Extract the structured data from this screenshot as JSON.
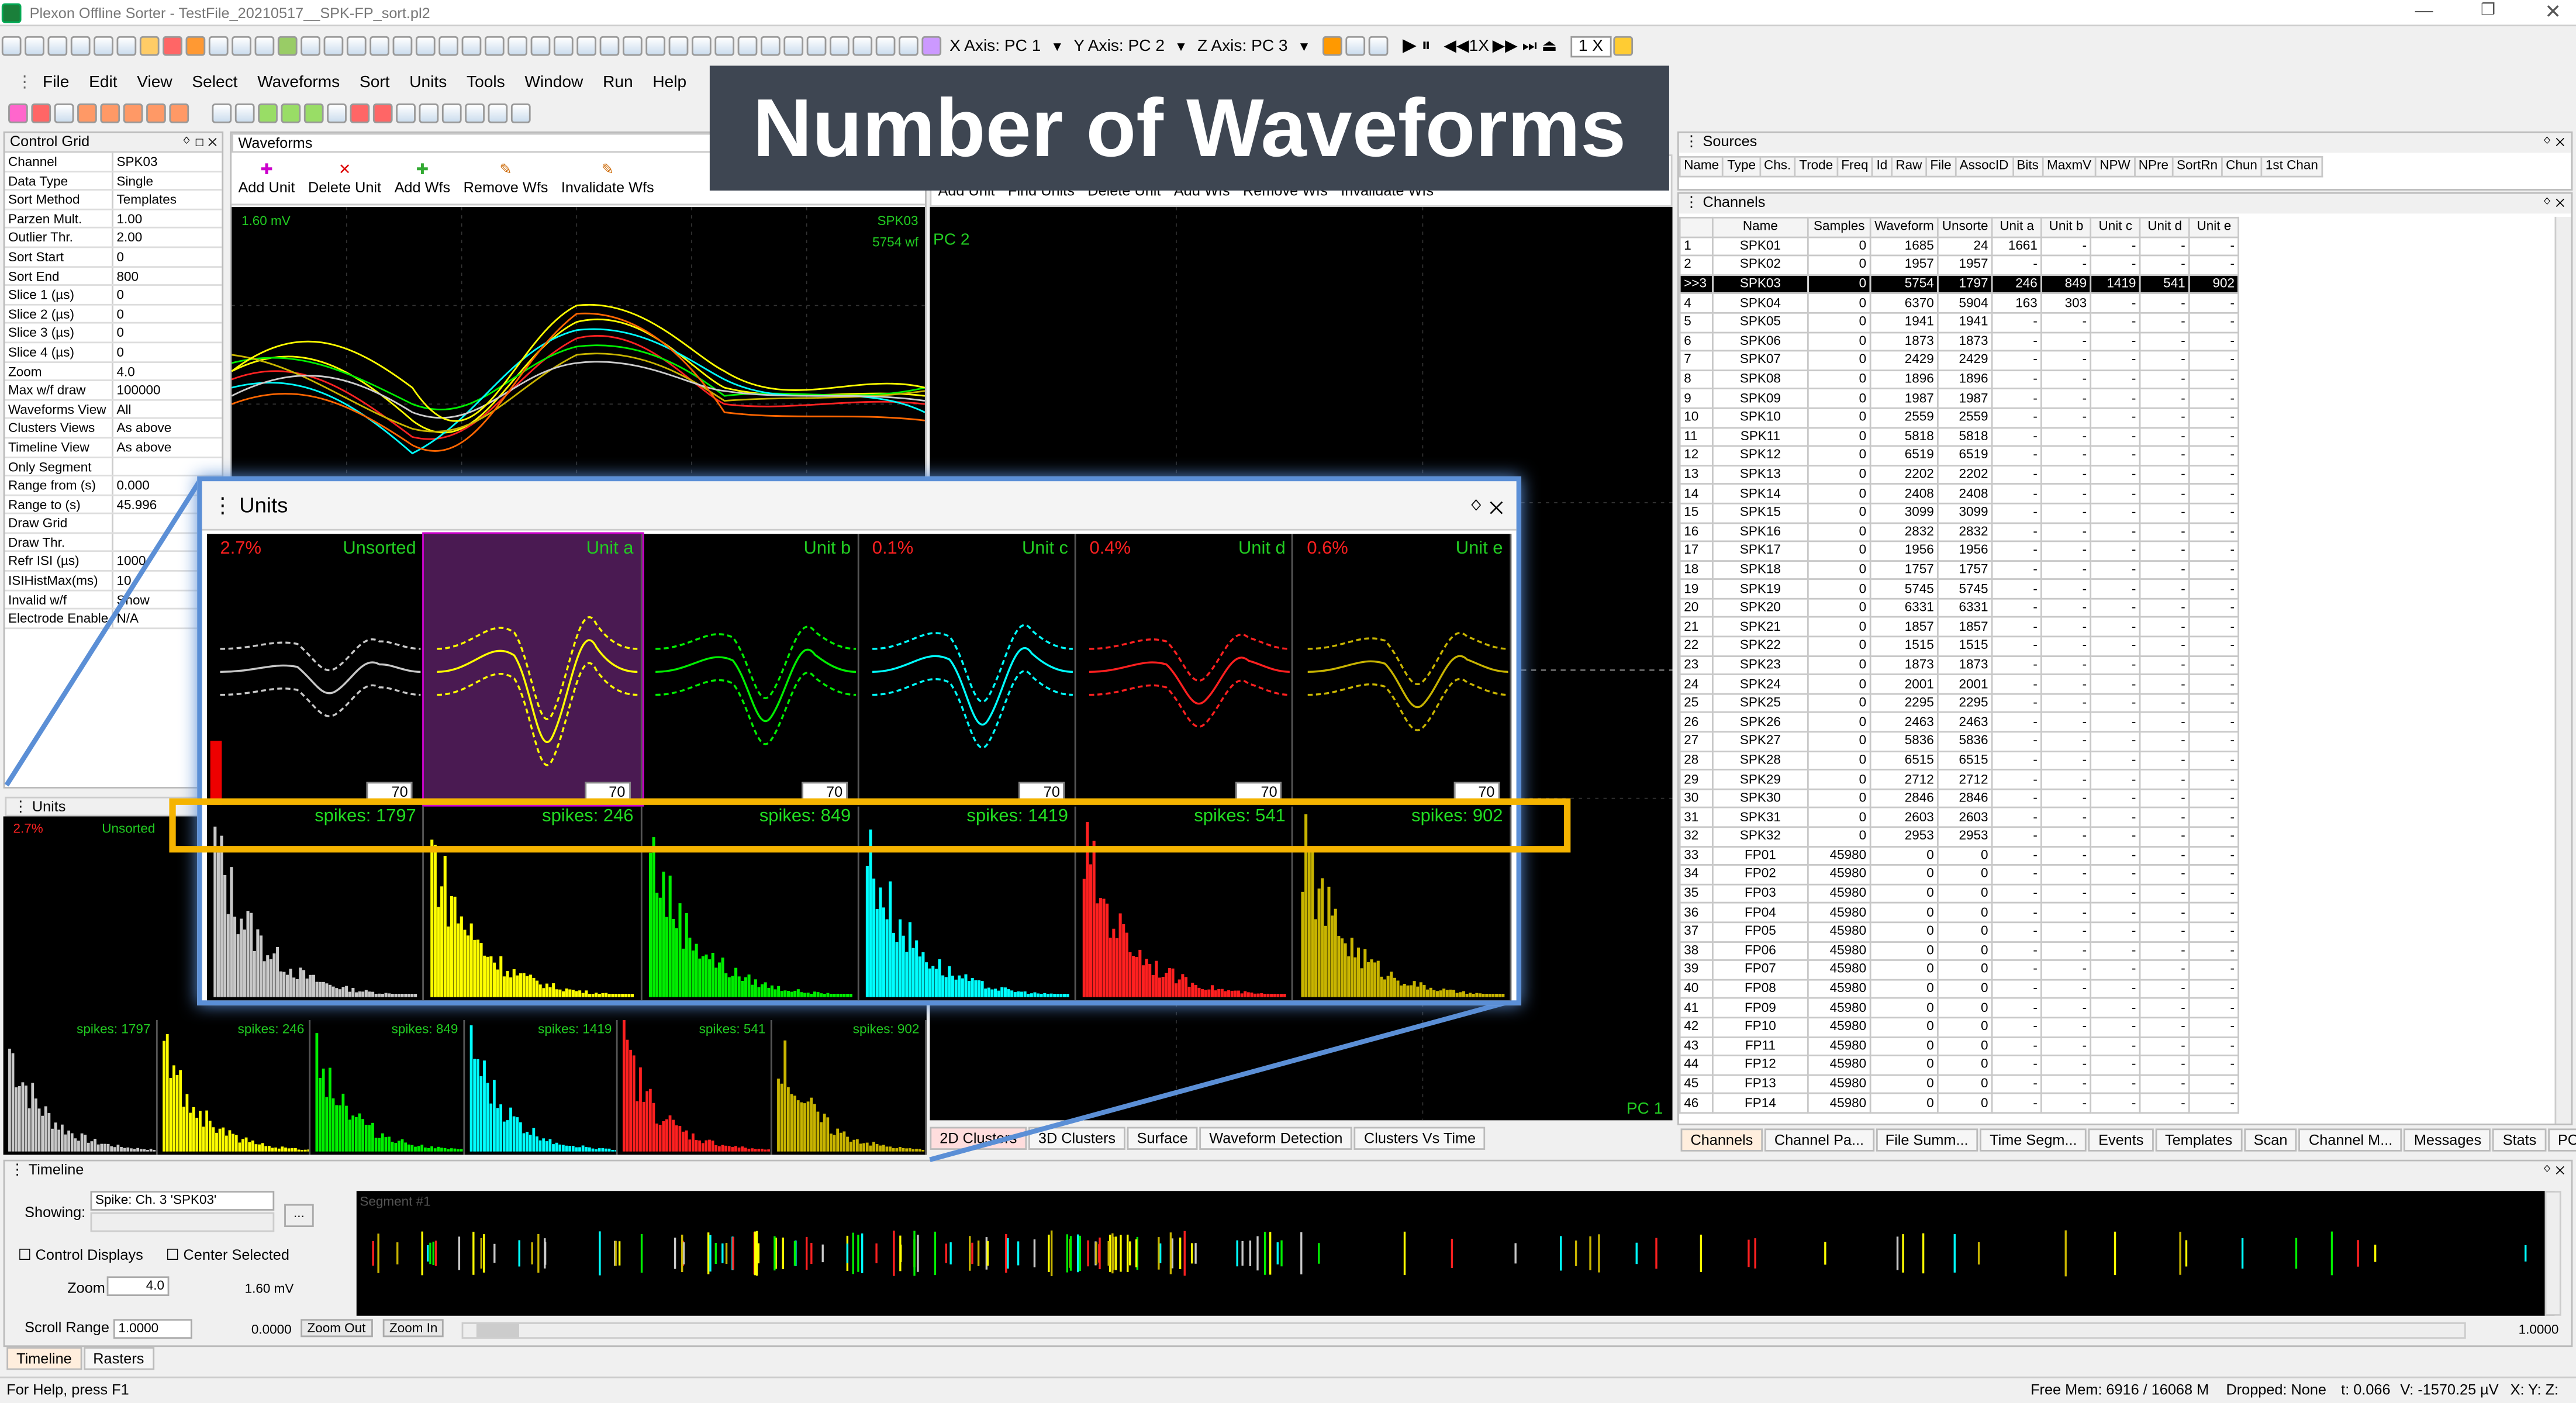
{
  "window": {
    "title": "Plexon Offline Sorter - TestFile_20210517__SPK-FP_sort.pl2"
  },
  "menu": [
    "File",
    "Edit",
    "View",
    "Select",
    "Waveforms",
    "Sort",
    "Units",
    "Tools",
    "Window",
    "Run",
    "Help"
  ],
  "toolbar": {
    "x_axis": "X Axis: PC 1",
    "y_axis": "Y Axis: PC 2",
    "z_axis": "Z Axis: PC 3",
    "speed": "1 X",
    "speed2": "1X"
  },
  "overlay_title": "Number of Waveforms",
  "control_grid": {
    "title": "Control Grid",
    "rows": [
      [
        "Channel",
        "SPK03"
      ],
      [
        "Data Type",
        "Single"
      ],
      [
        "Sort Method",
        "Templates"
      ],
      [
        "Parzen Mult.",
        "1.00"
      ],
      [
        "Outlier Thr.",
        "2.00"
      ],
      [
        "Sort Start",
        "0"
      ],
      [
        "Sort End",
        "800"
      ],
      [
        "Slice 1 (µs)",
        "0"
      ],
      [
        "Slice 2 (µs)",
        "0"
      ],
      [
        "Slice 3 (µs)",
        "0"
      ],
      [
        "Slice 4 (µs)",
        "0"
      ],
      [
        "Zoom",
        "4.0"
      ],
      [
        "Max w/f draw",
        "100000"
      ],
      [
        "Waveforms View",
        "All"
      ],
      [
        "Clusters Views",
        "As above"
      ],
      [
        "Timeline View",
        "As above"
      ],
      [
        "Only Segment",
        ""
      ],
      [
        "  Range from (s)",
        "0.000"
      ],
      [
        "  Range to (s)",
        "45.996"
      ],
      [
        "Draw Grid",
        ""
      ],
      [
        "Draw Thr.",
        ""
      ],
      [
        "Refr ISI (µs)",
        "1000"
      ],
      [
        "ISIHistMax(ms)",
        "10"
      ],
      [
        "Invalid w/f",
        "Show"
      ],
      [
        "Electrode Enable",
        "N/A"
      ]
    ]
  },
  "waveforms": {
    "title": "Waveforms",
    "buttons": [
      "Add Unit",
      "Delete Unit",
      "Add Wfs",
      "Remove Wfs",
      "Invalidate Wfs"
    ],
    "scale": "1.60 mV",
    "channel": "SPK03",
    "count": "5754 wf"
  },
  "clusters": {
    "buttons": [
      "Add Unit",
      "Find Units",
      "Delete Unit",
      "Add Wfs",
      "Remove Wfs",
      "Invalidate Wfs"
    ],
    "pc2": "PC 2",
    "pc1": "PC 1",
    "tabs": [
      "2D Clusters",
      "3D Clusters",
      "Surface",
      "Waveform Detection",
      "Clusters Vs Time"
    ]
  },
  "units": {
    "title": "Units",
    "cells": [
      {
        "name": "Unsorted",
        "pct": "2.7%",
        "spikes": "spikes: 1797",
        "color": "#c8c8c8"
      },
      {
        "name": "Unit a",
        "pct": "",
        "spikes": "spikes: 246",
        "color": "#ffff00"
      },
      {
        "name": "Unit b",
        "pct": "",
        "spikes": "spikes: 849",
        "color": "#00ee00"
      },
      {
        "name": "Unit c",
        "pct": "0.1%",
        "spikes": "spikes: 1419",
        "color": "#00ffff"
      },
      {
        "name": "Unit d",
        "pct": "0.4%",
        "spikes": "spikes: 541",
        "color": "#ff2020"
      },
      {
        "name": "Unit e",
        "pct": "0.6%",
        "spikes": "spikes: 902",
        "color": "#c8b400"
      }
    ],
    "spin": "70"
  },
  "sources": {
    "title": "Sources",
    "cols": [
      "Name",
      "Type",
      "Chs.",
      "Trode",
      "Freq",
      "Id",
      "Raw",
      "File",
      "AssocID",
      "Bits",
      "MaxmV",
      "NPW",
      "NPre",
      "SortRn",
      "Chun",
      "1st Chan"
    ]
  },
  "channels": {
    "title": "Channels",
    "cols": [
      "",
      "Name",
      "Samples",
      "Waveform",
      "Unsorte",
      "Unit a",
      "Unit b",
      "Unit c",
      "Unit d",
      "Unit e"
    ],
    "rows": [
      [
        "1",
        "SPK01",
        "0",
        "1685",
        "24",
        "1661",
        "-",
        "-",
        "-",
        "-"
      ],
      [
        "2",
        "SPK02",
        "0",
        "1957",
        "1957",
        "-",
        "-",
        "-",
        "-",
        "-"
      ],
      [
        ">>3",
        "SPK03",
        "0",
        "5754",
        "1797",
        "246",
        "849",
        "1419",
        "541",
        "902"
      ],
      [
        "4",
        "SPK04",
        "0",
        "6370",
        "5904",
        "163",
        "303",
        "-",
        "-",
        "-"
      ],
      [
        "5",
        "SPK05",
        "0",
        "1941",
        "1941",
        "-",
        "-",
        "-",
        "-",
        "-"
      ],
      [
        "6",
        "SPK06",
        "0",
        "1873",
        "1873",
        "-",
        "-",
        "-",
        "-",
        "-"
      ],
      [
        "7",
        "SPK07",
        "0",
        "2429",
        "2429",
        "-",
        "-",
        "-",
        "-",
        "-"
      ],
      [
        "8",
        "SPK08",
        "0",
        "1896",
        "1896",
        "-",
        "-",
        "-",
        "-",
        "-"
      ],
      [
        "9",
        "SPK09",
        "0",
        "1987",
        "1987",
        "-",
        "-",
        "-",
        "-",
        "-"
      ],
      [
        "10",
        "SPK10",
        "0",
        "2559",
        "2559",
        "-",
        "-",
        "-",
        "-",
        "-"
      ],
      [
        "11",
        "SPK11",
        "0",
        "5818",
        "5818",
        "-",
        "-",
        "-",
        "-",
        "-"
      ],
      [
        "12",
        "SPK12",
        "0",
        "6519",
        "6519",
        "-",
        "-",
        "-",
        "-",
        "-"
      ],
      [
        "13",
        "SPK13",
        "0",
        "2202",
        "2202",
        "-",
        "-",
        "-",
        "-",
        "-"
      ],
      [
        "14",
        "SPK14",
        "0",
        "2408",
        "2408",
        "-",
        "-",
        "-",
        "-",
        "-"
      ],
      [
        "15",
        "SPK15",
        "0",
        "3099",
        "3099",
        "-",
        "-",
        "-",
        "-",
        "-"
      ],
      [
        "16",
        "SPK16",
        "0",
        "2832",
        "2832",
        "-",
        "-",
        "-",
        "-",
        "-"
      ],
      [
        "17",
        "SPK17",
        "0",
        "1956",
        "1956",
        "-",
        "-",
        "-",
        "-",
        "-"
      ],
      [
        "18",
        "SPK18",
        "0",
        "1757",
        "1757",
        "-",
        "-",
        "-",
        "-",
        "-"
      ],
      [
        "19",
        "SPK19",
        "0",
        "5745",
        "5745",
        "-",
        "-",
        "-",
        "-",
        "-"
      ],
      [
        "20",
        "SPK20",
        "0",
        "6331",
        "6331",
        "-",
        "-",
        "-",
        "-",
        "-"
      ],
      [
        "21",
        "SPK21",
        "0",
        "1857",
        "1857",
        "-",
        "-",
        "-",
        "-",
        "-"
      ],
      [
        "22",
        "SPK22",
        "0",
        "1515",
        "1515",
        "-",
        "-",
        "-",
        "-",
        "-"
      ],
      [
        "23",
        "SPK23",
        "0",
        "1873",
        "1873",
        "-",
        "-",
        "-",
        "-",
        "-"
      ],
      [
        "24",
        "SPK24",
        "0",
        "2001",
        "2001",
        "-",
        "-",
        "-",
        "-",
        "-"
      ],
      [
        "25",
        "SPK25",
        "0",
        "2295",
        "2295",
        "-",
        "-",
        "-",
        "-",
        "-"
      ],
      [
        "26",
        "SPK26",
        "0",
        "2463",
        "2463",
        "-",
        "-",
        "-",
        "-",
        "-"
      ],
      [
        "27",
        "SPK27",
        "0",
        "5836",
        "5836",
        "-",
        "-",
        "-",
        "-",
        "-"
      ],
      [
        "28",
        "SPK28",
        "0",
        "6515",
        "6515",
        "-",
        "-",
        "-",
        "-",
        "-"
      ],
      [
        "29",
        "SPK29",
        "0",
        "2712",
        "2712",
        "-",
        "-",
        "-",
        "-",
        "-"
      ],
      [
        "30",
        "SPK30",
        "0",
        "2846",
        "2846",
        "-",
        "-",
        "-",
        "-",
        "-"
      ],
      [
        "31",
        "SPK31",
        "0",
        "2603",
        "2603",
        "-",
        "-",
        "-",
        "-",
        "-"
      ],
      [
        "32",
        "SPK32",
        "0",
        "2953",
        "2953",
        "-",
        "-",
        "-",
        "-",
        "-"
      ],
      [
        "33",
        "FP01",
        "45980",
        "0",
        "0",
        "-",
        "-",
        "-",
        "-",
        "-"
      ],
      [
        "34",
        "FP02",
        "45980",
        "0",
        "0",
        "-",
        "-",
        "-",
        "-",
        "-"
      ],
      [
        "35",
        "FP03",
        "45980",
        "0",
        "0",
        "-",
        "-",
        "-",
        "-",
        "-"
      ],
      [
        "36",
        "FP04",
        "45980",
        "0",
        "0",
        "-",
        "-",
        "-",
        "-",
        "-"
      ],
      [
        "37",
        "FP05",
        "45980",
        "0",
        "0",
        "-",
        "-",
        "-",
        "-",
        "-"
      ],
      [
        "38",
        "FP06",
        "45980",
        "0",
        "0",
        "-",
        "-",
        "-",
        "-",
        "-"
      ],
      [
        "39",
        "FP07",
        "45980",
        "0",
        "0",
        "-",
        "-",
        "-",
        "-",
        "-"
      ],
      [
        "40",
        "FP08",
        "45980",
        "0",
        "0",
        "-",
        "-",
        "-",
        "-",
        "-"
      ],
      [
        "41",
        "FP09",
        "45980",
        "0",
        "0",
        "-",
        "-",
        "-",
        "-",
        "-"
      ],
      [
        "42",
        "FP10",
        "45980",
        "0",
        "0",
        "-",
        "-",
        "-",
        "-",
        "-"
      ],
      [
        "43",
        "FP11",
        "45980",
        "0",
        "0",
        "-",
        "-",
        "-",
        "-",
        "-"
      ],
      [
        "44",
        "FP12",
        "45980",
        "0",
        "0",
        "-",
        "-",
        "-",
        "-",
        "-"
      ],
      [
        "45",
        "FP13",
        "45980",
        "0",
        "0",
        "-",
        "-",
        "-",
        "-",
        "-"
      ],
      [
        "46",
        "FP14",
        "45980",
        "0",
        "0",
        "-",
        "-",
        "-",
        "-",
        "-"
      ]
    ]
  },
  "right_tabs": [
    "Channels",
    "Channel Pa...",
    "File Summ...",
    "Time Segm...",
    "Events",
    "Templates",
    "Scan",
    "Channel M...",
    "Messages",
    "Stats",
    "PCA Stats"
  ],
  "timeline": {
    "title": "Timeline",
    "showing_label": "Showing:",
    "showing": "Spike: Ch. 3 'SPK03'",
    "control_displays": "Control Displays",
    "center_selected": "Center Selected",
    "zoom_label": "Zoom",
    "zoom": "4.0",
    "mv": "1.60 mV",
    "scroll_label": "Scroll Range",
    "scroll": "1.0000",
    "pos": "0.0000",
    "zoom_out": "Zoom Out",
    "zoom_in": "Zoom In",
    "segment": "Segment #1",
    "right_val": "1.0000"
  },
  "bottom_tabs": [
    "Timeline",
    "Rasters"
  ],
  "status": {
    "help": "For Help, press F1",
    "mem": "Free Mem: 6916 / 16068 M",
    "dropped": "Dropped: None",
    "t": "t: 0.066",
    "v": "V: -1570.25 µV",
    "xy": "X:   Y:   Z:"
  }
}
